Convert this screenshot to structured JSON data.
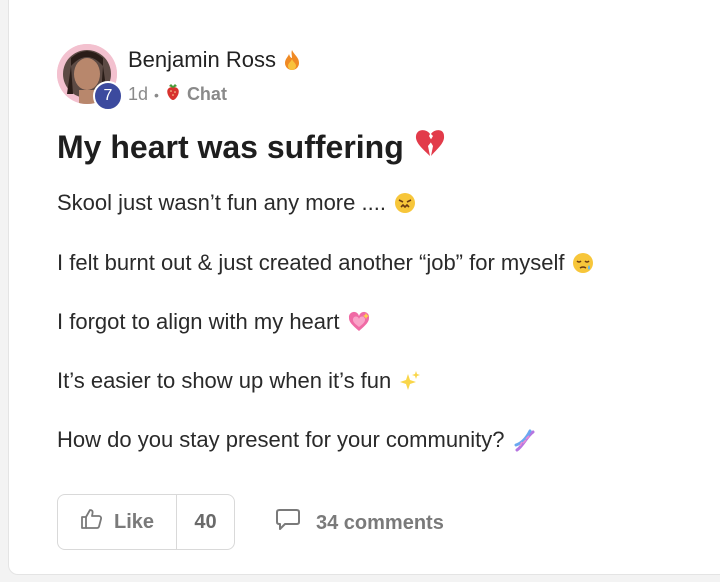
{
  "post": {
    "author": {
      "name": "Benjamin Ross",
      "level": "7"
    },
    "meta": {
      "time": "1d",
      "separator": "•",
      "category": "Chat"
    },
    "title": "My heart was suffering",
    "paragraphs": [
      {
        "text": "Skool just wasn’t fun any more ....",
        "emoji": "annoyed-face-icon"
      },
      {
        "text": "I felt burnt out & just created another “job” for myself",
        "emoji": "sleepy-face-icon"
      },
      {
        "text": "I forgot to align with my heart",
        "emoji": "sparkling-heart-icon"
      },
      {
        "text": "It’s easier to show up when it’s fun",
        "emoji": "sparkles-icon"
      },
      {
        "text": "How do you stay present for your community?",
        "emoji": "dna-icon"
      }
    ],
    "actions": {
      "like_label": "Like",
      "like_count": "40",
      "comments_label": "34 comments"
    }
  },
  "colors": {
    "level_badge": "#3c4a9e",
    "text_primary": "#1e1e1e",
    "text_muted": "#8a8a8a"
  }
}
